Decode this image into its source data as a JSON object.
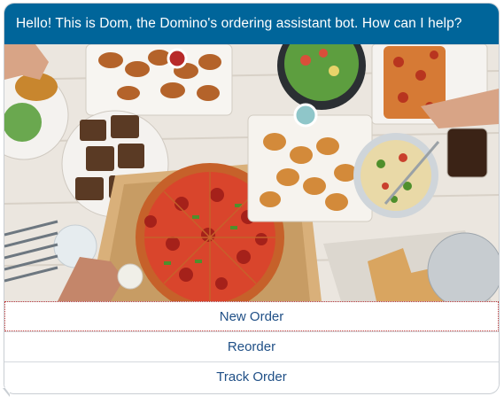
{
  "chat": {
    "greeting": "Hello! This is Dom, the Domino's ordering assistant bot. How can I help?",
    "image_alt": "Table spread with Domino's pizza, wings, salads, breads and desserts",
    "options": [
      {
        "label": "New Order"
      },
      {
        "label": "Reorder"
      },
      {
        "label": "Track Order"
      }
    ]
  },
  "colors": {
    "header_bg": "#00659a",
    "option_text": "#1f4f86",
    "focus_outline": "#c23b3b"
  }
}
